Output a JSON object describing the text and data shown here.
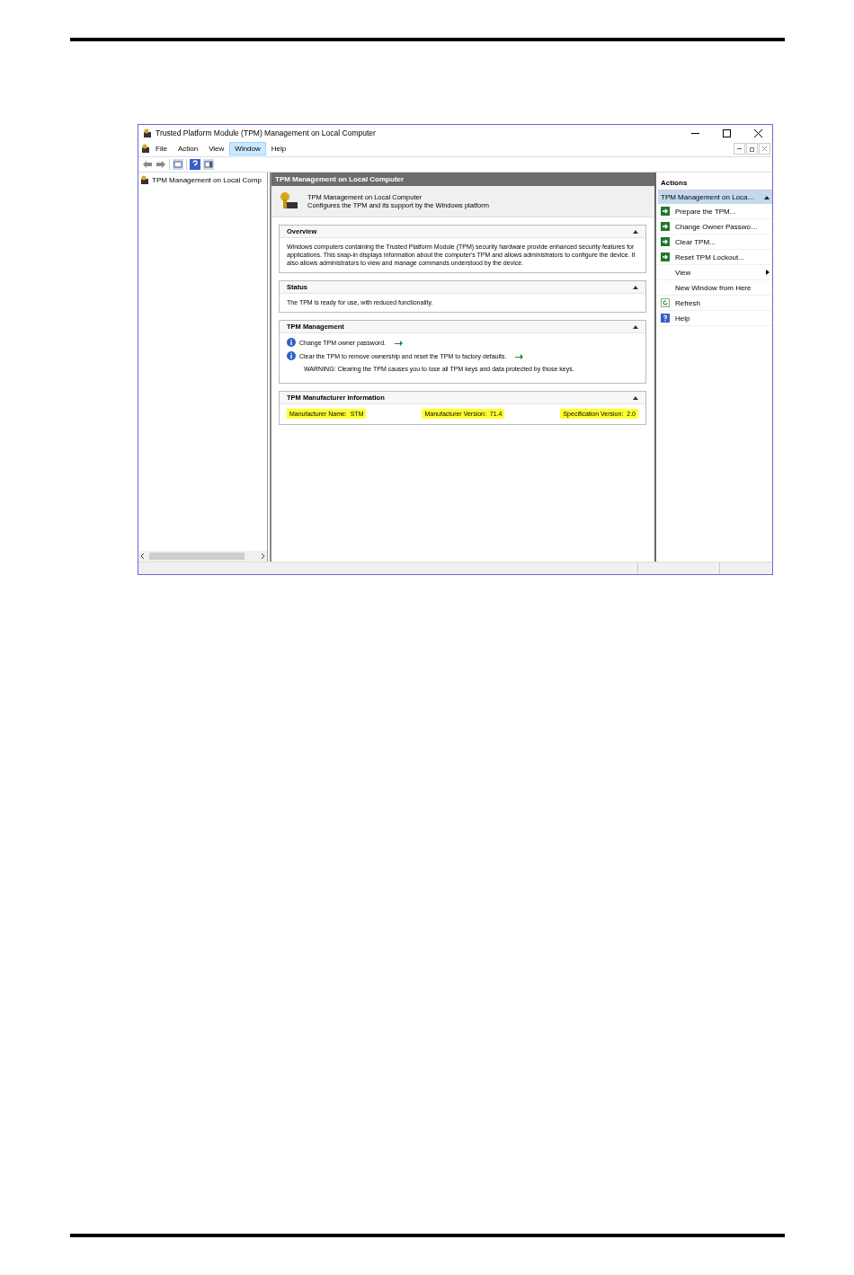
{
  "window": {
    "title": "Trusted Platform Module (TPM) Management on Local Computer"
  },
  "menu": [
    {
      "label": "File",
      "selected": false
    },
    {
      "label": "Action",
      "selected": false
    },
    {
      "label": "View",
      "selected": false
    },
    {
      "label": "Window",
      "selected": true
    },
    {
      "label": "Help",
      "selected": false
    }
  ],
  "tree": {
    "items": [
      {
        "label": "TPM Management on Local Comp"
      }
    ]
  },
  "center": {
    "title": "TPM Management on Local Computer",
    "header": {
      "title": "TPM Management on Local Computer",
      "description": "Configures the TPM and its support by the Windows platform"
    },
    "sections": [
      {
        "title": "Overview",
        "expanded": true,
        "kind": "text",
        "text": "Windows computers containing the Trusted Platform Module (TPM) security hardware provide enhanced security features for applications. This snap-in displays information about the computer's TPM and allows administrators to configure the device. It also allows administrators to view and manage commands understood by the device."
      },
      {
        "title": "Status",
        "expanded": true,
        "kind": "text",
        "text": "The TPM is ready for use, with reduced functionality."
      },
      {
        "title": "TPM Management",
        "expanded": true,
        "kind": "tasks",
        "tasks": [
          {
            "kind": "link",
            "text": "Change TPM owner password."
          },
          {
            "kind": "link",
            "text": "Clear the TPM to remove ownership and reset the TPM to factory defaults."
          },
          {
            "kind": "note",
            "text": "WARNING: Clearing the TPM causes you to lose all TPM keys and data protected by those keys."
          }
        ]
      },
      {
        "title": "TPM Manufacturer Information",
        "expanded": true,
        "kind": "fields",
        "fields": [
          {
            "label": "Manufacturer Name:",
            "value": "STM",
            "highlighted": true
          },
          {
            "label": "Manufacturer Version:",
            "value": "71.4",
            "highlighted": true
          },
          {
            "label": "Specification Version:",
            "value": "2.0",
            "highlighted": true
          }
        ]
      }
    ]
  },
  "actions": {
    "title": "Actions",
    "group": "TPM Management on Loca…",
    "items": [
      {
        "kind": "action",
        "label": "Prepare the TPM..."
      },
      {
        "kind": "action",
        "label": "Change Owner Passwo…"
      },
      {
        "kind": "action",
        "label": "Clear TPM..."
      },
      {
        "kind": "action",
        "label": "Reset TPM Lockout..."
      },
      {
        "kind": "submenu",
        "label": "View"
      },
      {
        "kind": "plain",
        "label": "New Window from Here"
      },
      {
        "kind": "refresh",
        "label": "Refresh"
      },
      {
        "kind": "help",
        "label": "Help"
      }
    ]
  }
}
